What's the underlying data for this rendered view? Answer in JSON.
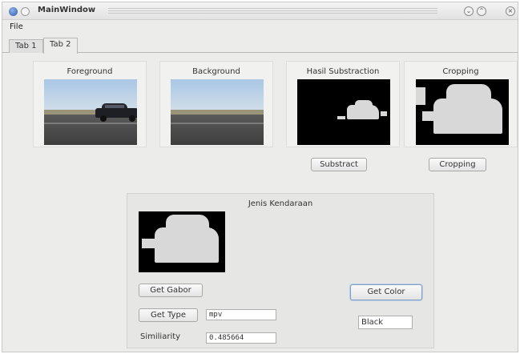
{
  "window": {
    "title": "MainWindow"
  },
  "menu": {
    "file": "File"
  },
  "tabs": [
    {
      "label": "Tab 1"
    },
    {
      "label": "Tab 2"
    }
  ],
  "panels": {
    "foreground": "Foreground",
    "background": "Background",
    "substraction": "Hasil Substraction",
    "cropping": "Cropping"
  },
  "buttons": {
    "substract": "Substract",
    "cropping": "Cropping",
    "get_gabor": "Get Gabor",
    "get_type": "Get Type",
    "get_color": "Get Color"
  },
  "group": {
    "title": "Jenis Kendaraan",
    "type_value": "mpv",
    "similarity_label": "Similiarity",
    "similarity_value": "0.485664",
    "color_value": "Black"
  },
  "icons": {
    "app": "app-icon",
    "minimize": "minimize-icon",
    "maximize": "maximize-icon",
    "close": "close-icon"
  }
}
